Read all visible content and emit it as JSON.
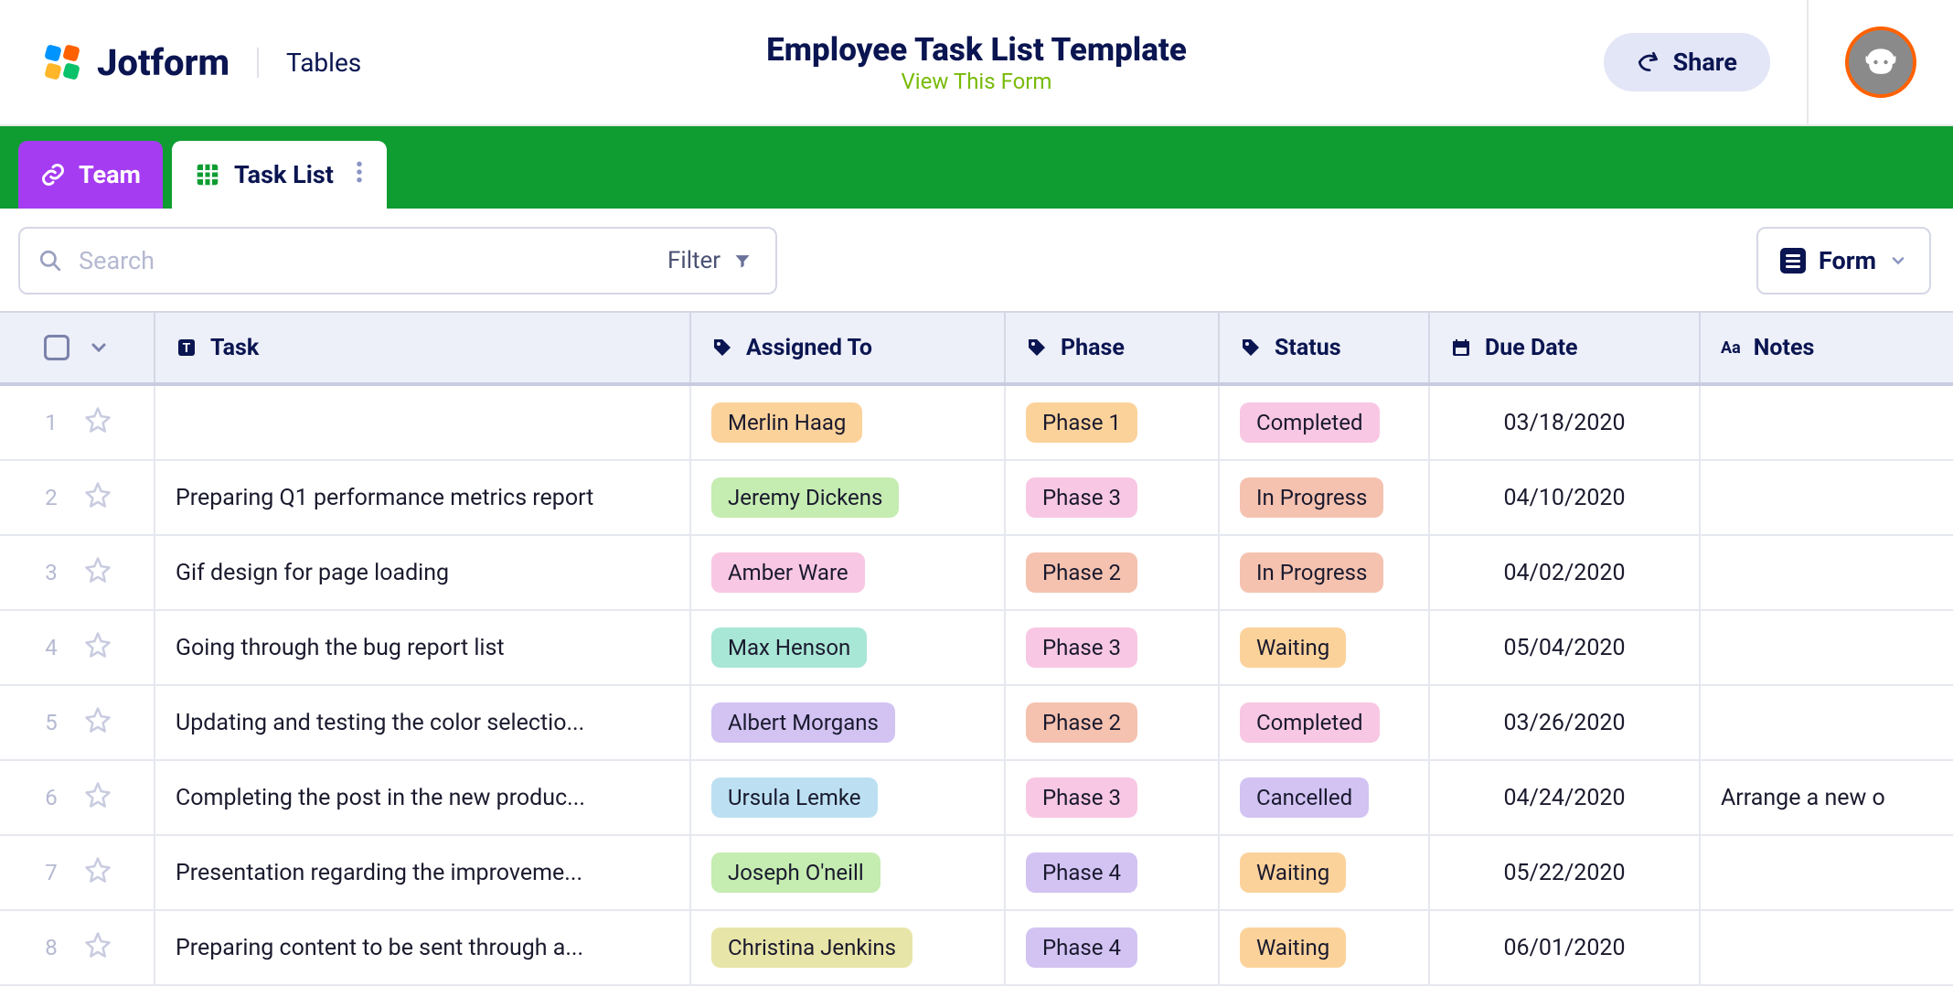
{
  "header": {
    "logo_text": "Jotform",
    "tables_label": "Tables",
    "title": "Employee Task List Template",
    "view_form": "View This Form",
    "share_label": "Share"
  },
  "tabs": {
    "team": "Team",
    "tasklist": "Task List"
  },
  "toolbar": {
    "search_placeholder": "Search",
    "filter_label": "Filter",
    "form_label": "Form"
  },
  "columns": {
    "task": "Task",
    "assigned": "Assigned To",
    "phase": "Phase",
    "status": "Status",
    "due": "Due Date",
    "notes": "Notes"
  },
  "tag_colors": {
    "Merlin Haag": "#fcd29b",
    "Jeremy Dickens": "#c5ecb1",
    "Amber Ware": "#f8c7e3",
    "Max Henson": "#a8e6d5",
    "Albert Morgans": "#d2c3f3",
    "Ursula Lemke": "#bce0f2",
    "Joseph O'neill": "#c5ecb1",
    "Christina Jenkins": "#e8e5a8",
    "Phase 1": "#fcd29b",
    "Phase 2": "#f5c2b0",
    "Phase 3": "#f8c7e3",
    "Phase 4": "#d2c3f3",
    "Completed": "#f8c7e3",
    "In Progress": "#f5c2b0",
    "Waiting": "#fcd29b",
    "Cancelled": "#d2c3f3"
  },
  "rows": [
    {
      "n": "1",
      "task": "",
      "assigned": "Merlin Haag",
      "phase": "Phase 1",
      "status": "Completed",
      "due": "03/18/2020",
      "notes": ""
    },
    {
      "n": "2",
      "task": "Preparing Q1 performance metrics report",
      "assigned": "Jeremy Dickens",
      "phase": "Phase 3",
      "status": "In Progress",
      "due": "04/10/2020",
      "notes": ""
    },
    {
      "n": "3",
      "task": "Gif design for page loading",
      "assigned": "Amber Ware",
      "phase": "Phase 2",
      "status": "In Progress",
      "due": "04/02/2020",
      "notes": ""
    },
    {
      "n": "4",
      "task": "Going through the bug report list",
      "assigned": "Max Henson",
      "phase": "Phase 3",
      "status": "Waiting",
      "due": "05/04/2020",
      "notes": ""
    },
    {
      "n": "5",
      "task": "Updating and testing the color selectio...",
      "assigned": "Albert Morgans",
      "phase": "Phase 2",
      "status": "Completed",
      "due": "03/26/2020",
      "notes": ""
    },
    {
      "n": "6",
      "task": "Completing the post in the new produc...",
      "assigned": "Ursula Lemke",
      "phase": "Phase 3",
      "status": "Cancelled",
      "due": "04/24/2020",
      "notes": "Arrange a new o"
    },
    {
      "n": "7",
      "task": "Presentation regarding the improveme...",
      "assigned": "Joseph O'neill",
      "phase": "Phase 4",
      "status": "Waiting",
      "due": "05/22/2020",
      "notes": ""
    },
    {
      "n": "8",
      "task": "Preparing content to be sent through a...",
      "assigned": "Christina Jenkins",
      "phase": "Phase 4",
      "status": "Waiting",
      "due": "06/01/2020",
      "notes": ""
    }
  ]
}
